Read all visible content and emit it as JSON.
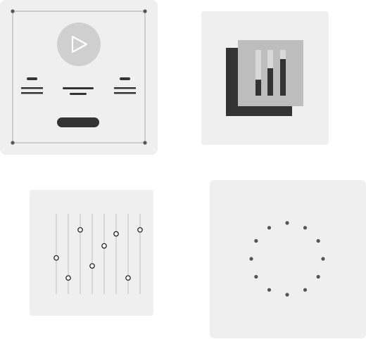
{
  "colors": {
    "card_bg": "#efefef",
    "dark": "#333333",
    "mid": "#bdbdbd",
    "light": "#d9d9d9",
    "line": "#c8c8c8",
    "handle_outline": "#222222",
    "dot": "#555555"
  },
  "icons": {
    "tile_1": "media-player-icon",
    "tile_2": "stacked-bar-chart-icon",
    "tile_3": "equalizer-sliders-icon",
    "tile_4": "loading-spinner-icon"
  },
  "bar_chart_icon": {
    "bar_fill_levels": [
      0.35,
      0.6,
      0.8
    ]
  },
  "equalizer_icon": {
    "slider_levels": [
      0.45,
      0.2,
      0.8,
      0.35,
      0.6,
      0.75,
      0.2,
      0.8
    ]
  },
  "spinner_icon": {
    "dot_count": 12
  }
}
